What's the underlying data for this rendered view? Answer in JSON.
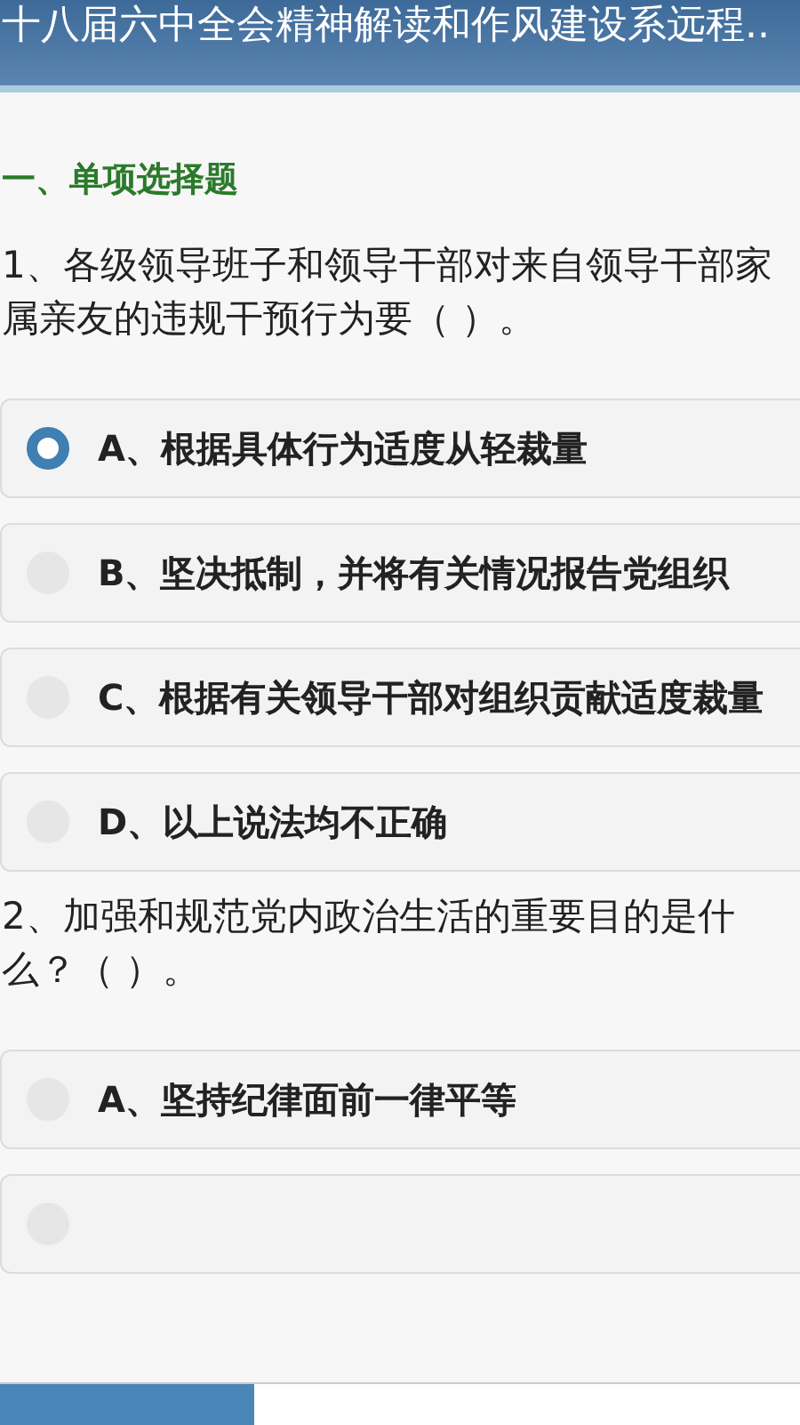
{
  "header": {
    "title": "十八届六中全会精神解读和作风建设系远程.."
  },
  "section": {
    "title": "一、单项选择题"
  },
  "questions": [
    {
      "text": "1、各级领导班子和领导干部对来自领导干部家属亲友的违规干预行为要（ ）。",
      "options": [
        {
          "text": "A、根据具体行为适度从轻裁量",
          "selected": true
        },
        {
          "text": "B、坚决抵制，并将有关情况报告党组织",
          "selected": false
        },
        {
          "text": "C、根据有关领导干部对组织贡献适度裁量",
          "selected": false
        },
        {
          "text": "D、以上说法均不正确",
          "selected": false
        }
      ]
    },
    {
      "text": "2、加强和规范党内政治生活的重要目的是什么？（ ）。",
      "options": [
        {
          "text": "A、坚持纪律面前一律平等",
          "selected": false
        },
        {
          "selected": false
        }
      ]
    }
  ]
}
